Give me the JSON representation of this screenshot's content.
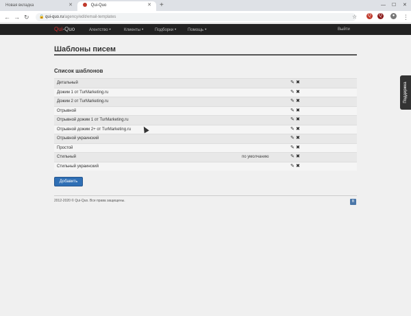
{
  "browser": {
    "tabs": [
      {
        "label": "Новая вкладка",
        "active": false
      },
      {
        "label": "Qui-Quo",
        "active": true
      }
    ],
    "url_host": "qui-quo.ru",
    "url_path": "/agency/edit/email-templates"
  },
  "nav": {
    "logo_q": "Qui",
    "logo_rest": "-Quo",
    "items": [
      {
        "label": "Агентство"
      },
      {
        "label": "Клиенты"
      },
      {
        "label": "Подборки"
      },
      {
        "label": "Помощь"
      }
    ],
    "logout": "Выйти"
  },
  "page": {
    "title": "Шаблоны писем",
    "section_title": "Список шаблонов",
    "templates": [
      {
        "name": "Детальный",
        "default": ""
      },
      {
        "name": "Дожим 1 от TurMarketing.ru",
        "default": ""
      },
      {
        "name": "Дожим 2 от TurMarketing.ru",
        "default": ""
      },
      {
        "name": "Отрывной",
        "default": ""
      },
      {
        "name": "Отрывной дожим 1 от TurMarketing.ru",
        "default": ""
      },
      {
        "name": "Отрывной дожим 2+ от TurMarketing.ru",
        "default": ""
      },
      {
        "name": "Отрывной украинский",
        "default": ""
      },
      {
        "name": "Простой",
        "default": ""
      },
      {
        "name": "Стильный",
        "default": "по умолчанию"
      },
      {
        "name": "Стильный украинский",
        "default": ""
      }
    ],
    "add_button": "Добавить"
  },
  "footer": {
    "copyright": "2012-2020 © Qui-Quo. Все права защищены.",
    "vk": "В"
  },
  "support": {
    "label": "Поддержка"
  },
  "colors": {
    "nav_bg": "#222222",
    "brand": "#d32f2f",
    "button": "#2f6fb5"
  }
}
